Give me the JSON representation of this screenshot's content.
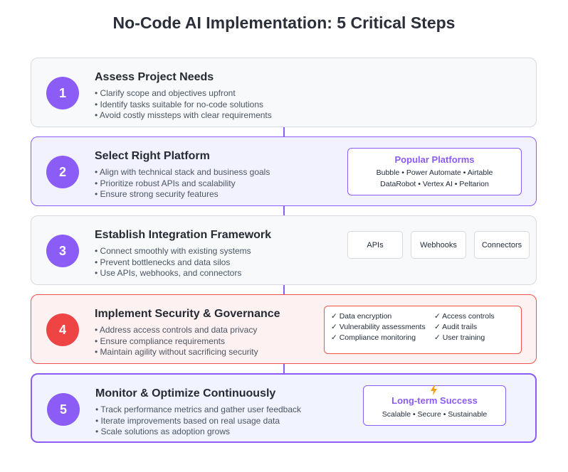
{
  "title": "No-Code AI Implementation: 5 Critical Steps",
  "steps": [
    {
      "number": "1",
      "title": "Assess Project Needs",
      "bullets": [
        "Clarify scope and objectives upfront",
        "Identify tasks suitable for no-code solutions",
        "Avoid costly missteps with clear requirements"
      ]
    },
    {
      "number": "2",
      "title": "Select Right Platform",
      "bullets": [
        "Align with technical stack and business goals",
        "Prioritize robust APIs and scalability",
        "Ensure strong security features"
      ],
      "panel": {
        "title": "Popular Platforms",
        "line1": "Bubble • Power Automate • Airtable",
        "line2": "DataRobot • Vertex AI • Peltarion"
      }
    },
    {
      "number": "3",
      "title": "Establish Integration Framework",
      "bullets": [
        "Connect smoothly with existing systems",
        "Prevent bottlenecks and data silos",
        "Use APIs, webhooks, and connectors"
      ],
      "chips": [
        "APIs",
        "Webhooks",
        "Connectors"
      ]
    },
    {
      "number": "4",
      "title": "Implement Security & Governance",
      "bullets": [
        "Address access controls and data privacy",
        "Ensure compliance requirements",
        "Maintain agility without sacrificing security"
      ],
      "checks_left": [
        "✓ Data encryption",
        "✓ Vulnerability assessments",
        "✓ Compliance monitoring"
      ],
      "checks_right": [
        "✓ Access controls",
        "✓ Audit trails",
        "✓ User training"
      ]
    },
    {
      "number": "5",
      "title": "Monitor & Optimize Continuously",
      "bullets": [
        "Track performance metrics and gather user feedback",
        "Iterate improvements based on real usage data",
        "Scale solutions as adoption grows"
      ],
      "panel": {
        "title": "Long-term Success",
        "line1": "Scalable • Secure • Sustainable"
      }
    }
  ],
  "colors": {
    "accent": "#8b5cf6",
    "danger": "#ef4444",
    "title_text": "#2b2f3a"
  },
  "icons": {
    "success_icon": "lightning-bolt-icon"
  }
}
